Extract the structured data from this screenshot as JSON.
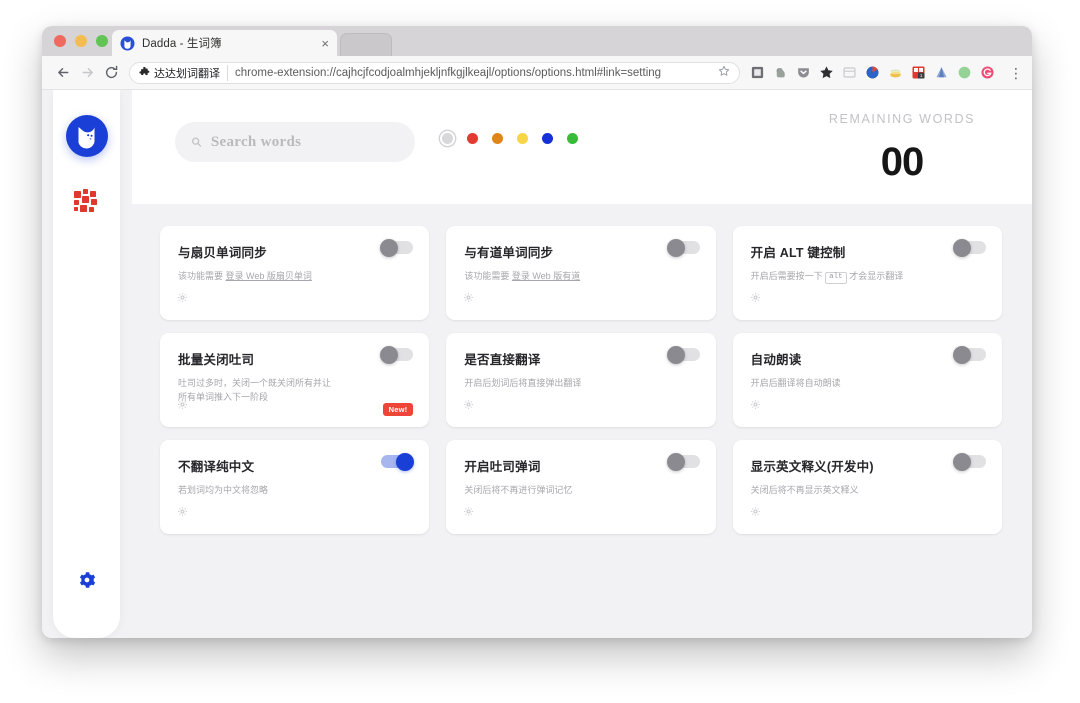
{
  "browser": {
    "tab": {
      "title": "Dadda - 生词簿",
      "favicon": "dadda-logo-icon",
      "close": "×"
    },
    "new_tab_label": "",
    "nav": {
      "back": "back-arrow-icon",
      "forward": "forward-arrow-icon",
      "reload": "reload-icon"
    },
    "omnibox": {
      "extension_chip": "达达划词翻译",
      "url": "chrome-extension://cajhcjfcodjoalmhjekljnfkgjlkeajl/options/options.html#link=setting",
      "star": "star-icon"
    },
    "extension_icons": [
      {
        "name": "reading-list-icon",
        "color": "#7a7a7a"
      },
      {
        "name": "evernote-icon",
        "color": "#9aa09a"
      },
      {
        "name": "pocket-icon",
        "color": "#8c8c92"
      },
      {
        "name": "bookmark-star-icon",
        "color": "#2f2f33"
      },
      {
        "name": "notes-icon",
        "color": "#cfcfd4"
      },
      {
        "name": "colorzilla-icon",
        "color": "#3a3a3a"
      },
      {
        "name": "honey-icon",
        "color": "#efc14e"
      },
      {
        "name": "tab-manager-icon",
        "color": "#e0392b"
      },
      {
        "name": "analytics-icon",
        "color": "#6f88c4"
      },
      {
        "name": "green-circle-icon",
        "color": "#8fd28f"
      },
      {
        "name": "grammarly-icon",
        "color": "#ef4b76"
      }
    ],
    "menu": "⋮"
  },
  "sidebar": {
    "logo": "dadda-cat-logo",
    "items": [
      {
        "name": "wordbook-grid",
        "icon": "grid-icon",
        "color": "#e0382c",
        "active": true
      }
    ],
    "settings": {
      "icon": "gear-icon",
      "color": "#1a3fd6"
    }
  },
  "header": {
    "search": {
      "placeholder": "Search words",
      "value": "",
      "icon": "search-icon"
    },
    "color_filters": [
      {
        "name": "filter-all",
        "color": "#d8d8dc",
        "selected": true
      },
      {
        "name": "filter-red",
        "color": "#e23b31",
        "selected": false
      },
      {
        "name": "filter-orange",
        "color": "#e08519",
        "selected": false
      },
      {
        "name": "filter-yellow",
        "color": "#f8d547",
        "selected": false
      },
      {
        "name": "filter-blue",
        "color": "#1632d6",
        "selected": false
      },
      {
        "name": "filter-green",
        "color": "#38bb38",
        "selected": false
      }
    ],
    "remaining": {
      "label": "REMAINING WORDS",
      "count": "00"
    }
  },
  "cards": [
    {
      "title": "与扇贝单词同步",
      "desc_prefix": "该功能需要 ",
      "desc_link": "登录 Web 版扇贝单词",
      "desc_suffix": "",
      "toggle_on": false,
      "badge": ""
    },
    {
      "title": "与有道单词同步",
      "desc_prefix": "该功能需要 ",
      "desc_link": "登录 Web 版有道",
      "desc_suffix": "",
      "toggle_on": false,
      "badge": ""
    },
    {
      "title": "开启 ALT 键控制",
      "desc_prefix": "开启后需要按一下 ",
      "desc_kbd": "alt",
      "desc_suffix": " 才会显示翻译",
      "toggle_on": false,
      "badge": ""
    },
    {
      "title": "批量关闭吐司",
      "desc_line1": "吐司过多时，关闭一个既关闭所有并让",
      "desc_line2": "所有单词推入下一阶段",
      "toggle_on": false,
      "badge": "New!"
    },
    {
      "title": "是否直接翻译",
      "desc_line1": "开启后划词后将直接弹出翻译",
      "toggle_on": false,
      "badge": ""
    },
    {
      "title": "自动朗读",
      "desc_line1": "开启后翻译将自动朗读",
      "toggle_on": false,
      "badge": ""
    },
    {
      "title": "不翻译纯中文",
      "desc_line1": "若划词均为中文将忽略",
      "toggle_on": true,
      "badge": ""
    },
    {
      "title": "开启吐司弹词",
      "desc_line1": "关闭后将不再进行弹词记忆",
      "toggle_on": false,
      "badge": ""
    },
    {
      "title": "显示英文释义(开发中)",
      "desc_line1": "关闭后将不再显示英文释义",
      "toggle_on": false,
      "badge": ""
    }
  ]
}
